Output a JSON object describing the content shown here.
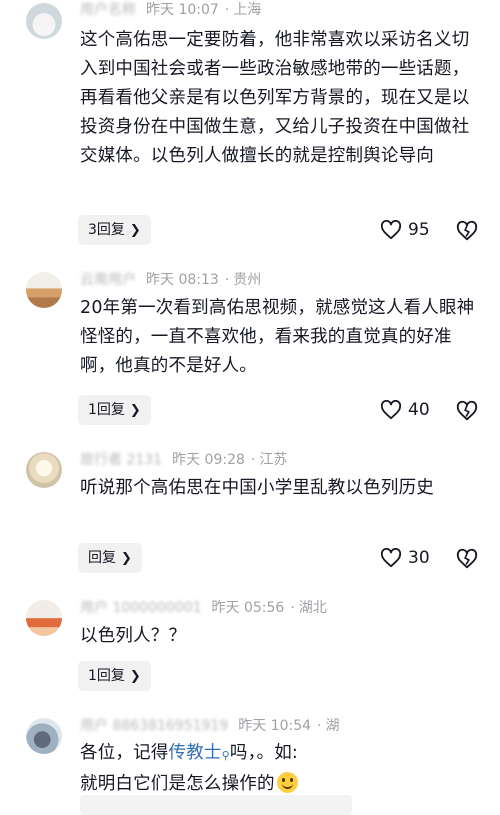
{
  "comments": [
    {
      "username": "用户名称",
      "time": "昨天 10:07",
      "location": "上海",
      "text": "这个高佑思一定要防着，他非常喜欢以采访名义切入到中国社会或者一些政治敏感地带的一些话题，再看看他父亲是有以色列军方背景的，现在又是以投资身份在中国做生意，又给儿子投资在中国做社交媒体。以色列人做擅长的就是控制舆论导向",
      "replies": "3回复",
      "likes": "95"
    },
    {
      "username": "云南用户",
      "time": "昨天 08:13",
      "location": "贵州",
      "text": "20年第一次看到高佑思视频，就感觉这人看人眼神怪怪的，一直不喜欢他，看来我的直觉真的好准啊，他真的不是好人。",
      "replies": "1回复",
      "likes": "40"
    },
    {
      "username": "旅行者 2131",
      "time": "昨天 09:28",
      "location": "江苏",
      "text": "听说那个高佑思在中国小学里乱教以色列历史",
      "replies": "回复",
      "likes": "30"
    },
    {
      "username": "用户 1000000001",
      "time": "昨天 05:56",
      "location": "湖北",
      "text": "以色列人？？",
      "replies": "1回复"
    },
    {
      "username": "用户 8863816951919",
      "time": "昨天 10:54",
      "location": "湖",
      "text_before": "各位，记得",
      "text_link": "传教士",
      "text_after": "吗，。如:",
      "text_line2": "就明白它们是怎么操作的"
    }
  ],
  "icons": {
    "like": "heart-outline-icon",
    "dislike": "broken-heart-icon",
    "chevron": "chevron-right-icon",
    "search": "search-icon",
    "emoji": "smile-emoji-icon"
  },
  "colors": {
    "text": "#161823",
    "meta": "#a0a1a6",
    "pill_bg": "#f1f1f2",
    "link": "#2f6fb5"
  }
}
